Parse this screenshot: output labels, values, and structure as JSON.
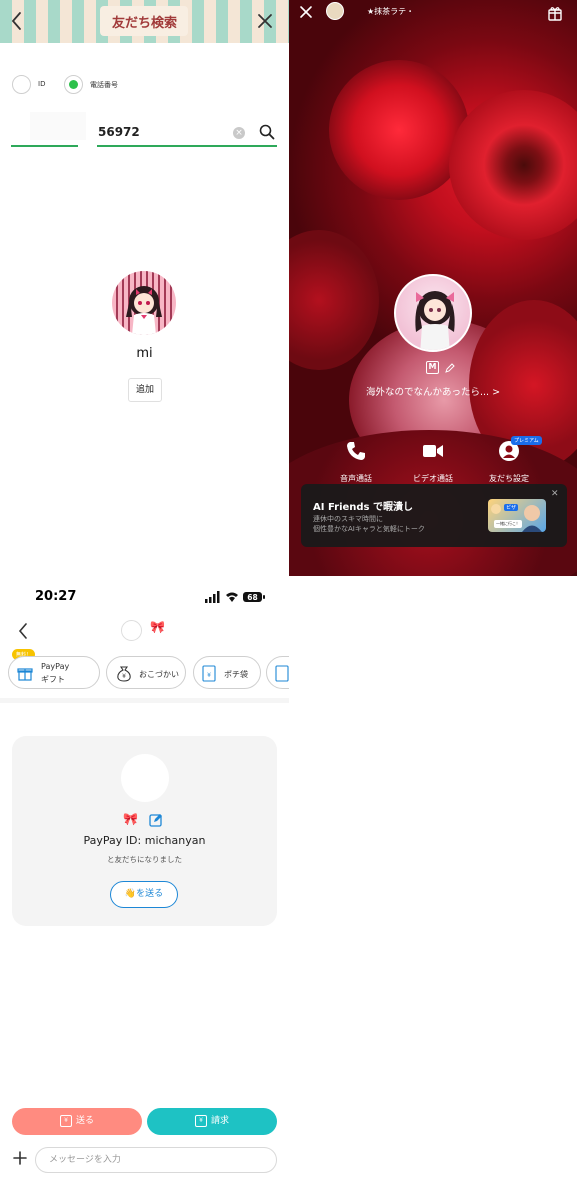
{
  "friend_search": {
    "title": "友だち検索",
    "options": [
      {
        "label": "ID",
        "selected": false
      },
      {
        "label": "電話番号",
        "selected": true
      }
    ],
    "search_value": "56972",
    "result_name": "mi",
    "add_label": "追加",
    "colors": {
      "accent": "#2ec14c",
      "title": "#a13a3a"
    }
  },
  "profile": {
    "top_name": "★抹茶ラテ・",
    "status_message": "海外なのでなんかあったら...",
    "m_badge": "M",
    "actions": [
      {
        "label": "音声通話",
        "icon": "phone-icon"
      },
      {
        "label": "ビデオ通話",
        "icon": "video-icon"
      },
      {
        "label": "友だち設定",
        "icon": "person-icon"
      }
    ],
    "premium_badge": "プレミアム",
    "banner": {
      "title": "AI Friends で暇潰し",
      "subtitle_line1": "連休中のスキマ時間に",
      "subtitle_line2": "個性豊かなAIキャラと気軽にトーク",
      "image_label1": "ピザ",
      "image_label2": "一緒に行こ！"
    }
  },
  "paypay_chat": {
    "time": "20:27",
    "battery": "68",
    "header_emoji": "🎀",
    "free_badge": "無料！",
    "pills": [
      {
        "label_line1": "PayPay",
        "label_line2": "ギフト",
        "icon": "gift-icon"
      },
      {
        "label_line1": "おこづかい",
        "icon": "moneybag-icon"
      },
      {
        "label_line1": "ポチ袋",
        "icon": "envelope-icon"
      }
    ],
    "card": {
      "emoji": "🎀",
      "paypay_id": "PayPay ID: michanyan",
      "subtitle": "と友だちになりました",
      "wave_button": "👋を送る"
    },
    "send_label": "送る",
    "request_label": "請求",
    "message_placeholder": "メッセージを入力",
    "colors": {
      "send": "#ff8b80",
      "request": "#1ec2c4",
      "link": "#1d87d6"
    }
  }
}
